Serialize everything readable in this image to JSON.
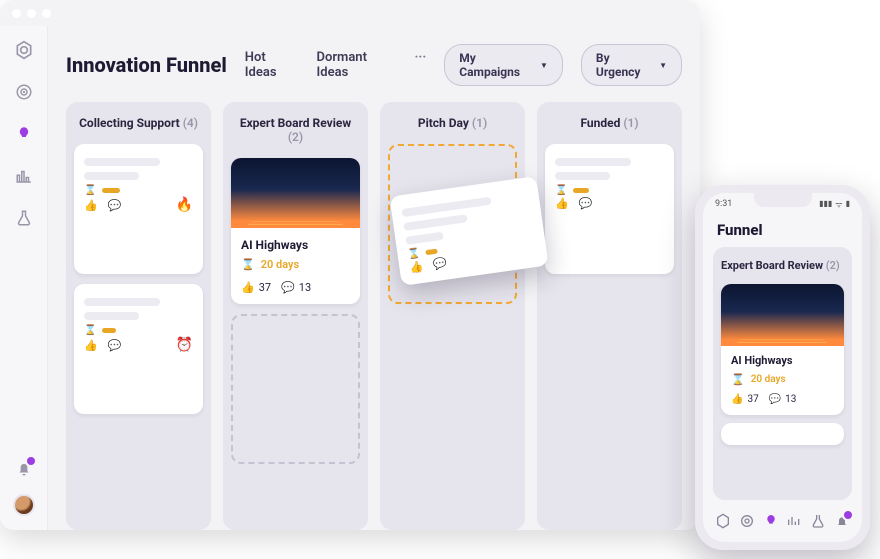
{
  "header": {
    "title": "Innovation Funnel",
    "tab_hot": "Hot Ideas",
    "tab_dormant": "Dormant Ideas",
    "pill_campaigns": "My Campaigns",
    "pill_urgency": "By Urgency"
  },
  "columns": [
    {
      "title": "Collecting Support",
      "count": "(4)"
    },
    {
      "title": "Expert Board Review",
      "count": "(2)"
    },
    {
      "title": "Pitch Day",
      "count": "(1)"
    },
    {
      "title": "Funded",
      "count": "(1)"
    }
  ],
  "card_ai": {
    "title": "AI Highways",
    "deadline": "20 days",
    "likes": "37",
    "comments": "13"
  },
  "phone": {
    "time": "9:31",
    "title": "Funnel",
    "col_title": "Expert Board Review",
    "col_count": "(2)",
    "card_title": "AI Highways",
    "card_deadline": "20 days",
    "card_likes": "37",
    "card_comments": "13"
  }
}
